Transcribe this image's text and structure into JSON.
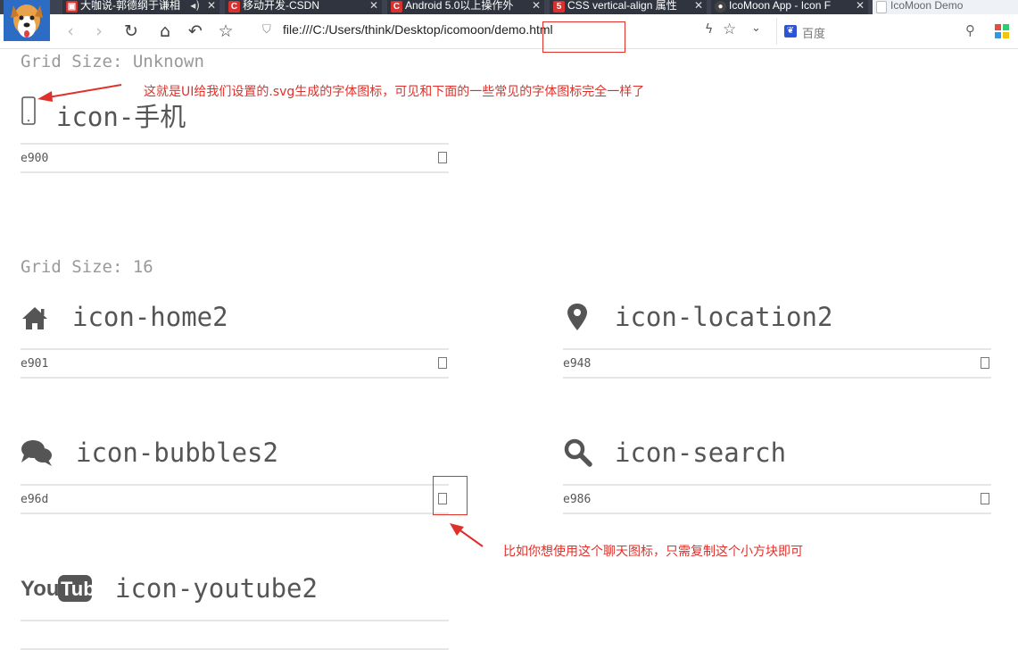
{
  "tabs": [
    {
      "title": "大咖说-郭德纲于谦相",
      "icon": "red-video-icon",
      "color": "#d93030"
    },
    {
      "title": "移动开发-CSDN",
      "icon": "csdn-icon",
      "color": "#d93030"
    },
    {
      "title": "Android 5.0以上操作外",
      "icon": "csdn-icon",
      "color": "#d93030"
    },
    {
      "title": "CSS vertical-align 属性",
      "icon": "w3-icon",
      "color": "#d93030"
    },
    {
      "title": "IcoMoon App - Icon F",
      "icon": "icomoon-icon",
      "color": "#444"
    },
    {
      "title": "IcoMoon Demo",
      "icon": "page-icon",
      "color": "#ccc"
    }
  ],
  "address": {
    "url": "file:///C:/Users/think/Desktop/icomoon/demo.html"
  },
  "search": {
    "placeholder": "百度"
  },
  "sections": [
    {
      "grid_label": "Grid Size: Unknown"
    },
    {
      "grid_label": "Grid Size: 16"
    }
  ],
  "glyphs": [
    {
      "name": "icon-手机",
      "code": "e900",
      "icon": "mobile-phone-icon"
    },
    {
      "name": "icon-home2",
      "code": "e901",
      "icon": "home-icon"
    },
    {
      "name": "icon-location2",
      "code": "e948",
      "icon": "location-pin-icon"
    },
    {
      "name": "icon-bubbles2",
      "code": "e96d",
      "icon": "chat-bubbles-icon"
    },
    {
      "name": "icon-search",
      "code": "e986",
      "icon": "magnifier-icon"
    },
    {
      "name": "icon-youtube2",
      "code": "",
      "icon": "youtube-logo-icon"
    }
  ],
  "annotations": {
    "top": "这就是UI给我们设置的.svg生成的字体图标，可见和下面的一些常见的字体图标完全一样了",
    "bottom": "比如你想使用这个聊天图标，只需复制这个小方块即可"
  },
  "colors": {
    "annotation": "#e0302a",
    "tab_bg": "#2f343f",
    "icon": "#555555"
  }
}
